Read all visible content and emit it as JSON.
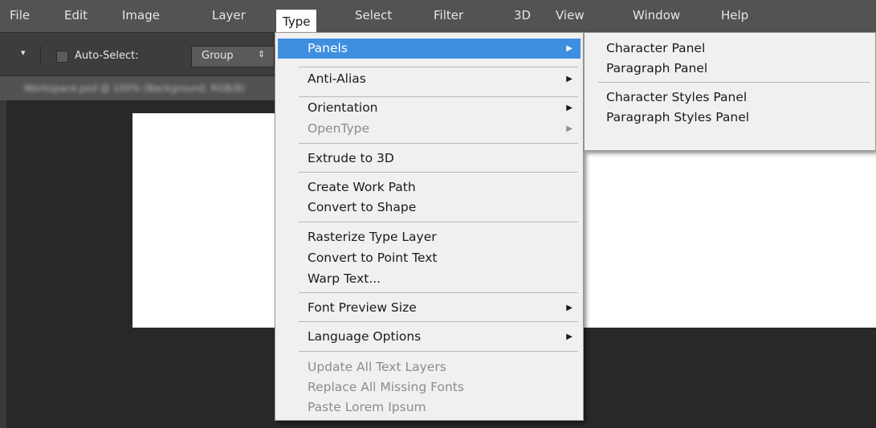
{
  "menubar": {
    "items": [
      "File",
      "Edit",
      "Image",
      "Layer",
      "Type",
      "Select",
      "Filter",
      "3D",
      "View",
      "Window",
      "Help"
    ]
  },
  "options_bar": {
    "auto_select_label": "Auto-Select:",
    "auto_select_value": "Group"
  },
  "type_menu": {
    "items": [
      {
        "label": "Panels",
        "submenu": true,
        "highlighted": true
      },
      {
        "label": "Anti-Alias",
        "submenu": true
      },
      {
        "label": "Orientation",
        "submenu": true
      },
      {
        "label": "OpenType",
        "submenu": true,
        "disabled": true
      },
      {
        "label": "Extrude to 3D"
      },
      {
        "label": "Create Work Path"
      },
      {
        "label": "Convert to Shape"
      },
      {
        "label": "Rasterize Type Layer"
      },
      {
        "label": "Convert to Point Text"
      },
      {
        "label": "Warp Text..."
      },
      {
        "label": "Font Preview Size",
        "submenu": true
      },
      {
        "label": "Language Options",
        "submenu": true
      },
      {
        "label": "Update All Text Layers",
        "disabled": true
      },
      {
        "label": "Replace All Missing Fonts",
        "disabled": true
      },
      {
        "label": "Paste Lorem Ipsum",
        "disabled": true
      }
    ]
  },
  "panels_submenu": {
    "items": [
      "Character Panel",
      "Paragraph Panel",
      "Character Styles Panel",
      "Paragraph Styles Panel"
    ]
  },
  "document_tab": {
    "label": "Workspace.psd @ 100% (Background, RGB/8)"
  },
  "colors": {
    "menubar_bg": "#535353",
    "menu_bg": "#f0f0f0",
    "highlight": "#3f8fe0",
    "canvas_bg": "#282828"
  }
}
